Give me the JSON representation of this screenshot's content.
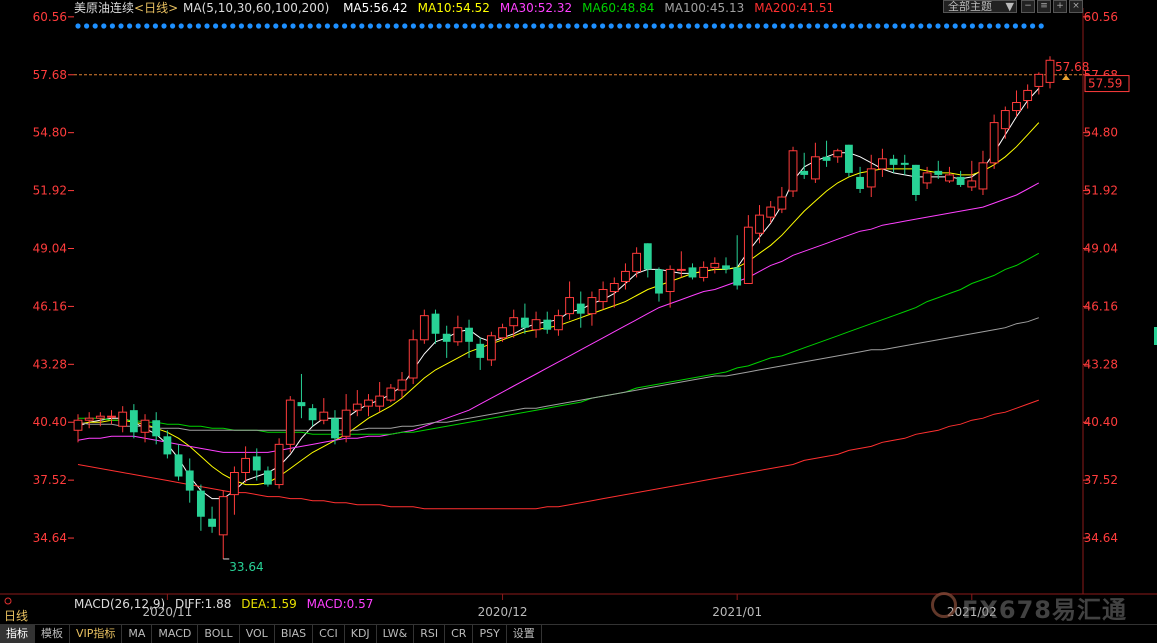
{
  "toolbar": {
    "symbol": "美原油连续",
    "period": "<日线>",
    "ma_params": "MA(5,10,30,60,100,200)",
    "ma_values": [
      {
        "label": "MA5:56.42",
        "color": "#ffffff"
      },
      {
        "label": "MA10:54.52",
        "color": "#ffff00"
      },
      {
        "label": "MA30:52.32",
        "color": "#ff40ff"
      },
      {
        "label": "MA60:48.84",
        "color": "#00d000"
      },
      {
        "label": "MA100:45.13",
        "color": "#a0a0a0"
      },
      {
        "label": "MA200:41.51",
        "color": "#ff3030"
      }
    ],
    "theme_button": "全部主题",
    "theme_arrow": "▼"
  },
  "indicator": {
    "name": "MACD(26,12,9)",
    "diff": "DIFF:1.88",
    "dea": "DEA:1.59",
    "macd": "MACD:0.57"
  },
  "left_tag": "日线",
  "tabs": [
    "指标",
    "模板",
    "VIP指标",
    "MA",
    "MACD",
    "BOLL",
    "VOL",
    "BIAS",
    "CCI",
    "KDJ",
    "LW&",
    "RSI",
    "CR",
    "PSY",
    "设置"
  ],
  "watermark": "FX678易汇通",
  "chart_data": {
    "type": "candlestick",
    "y_ticks": [
      "60.56",
      "57.68",
      "54.80",
      "51.92",
      "49.04",
      "46.16",
      "43.28",
      "40.40",
      "37.52",
      "34.64"
    ],
    "ylim": [
      33.3,
      61.0
    ],
    "x_labels": [
      {
        "label": "2020/11",
        "index": 8
      },
      {
        "label": "2020/12",
        "index": 38
      },
      {
        "label": "2021/01",
        "index": 59
      },
      {
        "label": "2021/02",
        "index": 80
      }
    ],
    "last_price": "57.68",
    "current_value": "57.59",
    "low_label": "33.64",
    "candles": [
      [
        40.0,
        40.5,
        39.4,
        40.8
      ],
      [
        40.5,
        40.6,
        40.1,
        40.9
      ],
      [
        40.6,
        40.7,
        40.2,
        40.9
      ],
      [
        40.7,
        40.7,
        40.3,
        41.0
      ],
      [
        40.2,
        40.9,
        39.9,
        41.2
      ],
      [
        41.0,
        39.9,
        39.6,
        41.3
      ],
      [
        39.9,
        40.5,
        39.4,
        40.8
      ],
      [
        40.5,
        39.7,
        39.3,
        40.9
      ],
      [
        39.7,
        38.8,
        38.6,
        40.0
      ],
      [
        38.8,
        37.7,
        37.5,
        39.3
      ],
      [
        38.0,
        37.0,
        36.4,
        38.6
      ],
      [
        37.0,
        35.7,
        35.0,
        37.3
      ],
      [
        35.6,
        35.2,
        34.9,
        36.2
      ],
      [
        34.8,
        36.7,
        33.6,
        37.0
      ],
      [
        36.8,
        37.9,
        35.8,
        38.2
      ],
      [
        37.9,
        38.6,
        37.4,
        39.2
      ],
      [
        38.7,
        38.0,
        37.5,
        39.1
      ],
      [
        38.0,
        37.3,
        37.2,
        38.2
      ],
      [
        37.3,
        39.3,
        37.1,
        39.6
      ],
      [
        39.3,
        41.5,
        38.9,
        41.7
      ],
      [
        41.4,
        41.2,
        40.6,
        42.8
      ],
      [
        41.1,
        40.5,
        40.2,
        41.3
      ],
      [
        40.5,
        40.9,
        40.3,
        41.6
      ],
      [
        40.6,
        39.6,
        39.3,
        41.0
      ],
      [
        39.7,
        41.0,
        39.4,
        41.8
      ],
      [
        41.0,
        41.3,
        40.7,
        42.0
      ],
      [
        41.2,
        41.5,
        40.7,
        41.8
      ],
      [
        41.2,
        41.7,
        40.9,
        42.4
      ],
      [
        41.5,
        42.1,
        41.4,
        42.3
      ],
      [
        42.0,
        42.5,
        41.6,
        42.9
      ],
      [
        42.6,
        44.5,
        42.3,
        45.0
      ],
      [
        44.5,
        45.7,
        44.3,
        46.0
      ],
      [
        45.8,
        44.8,
        44.3,
        46.0
      ],
      [
        44.8,
        44.4,
        43.6,
        45.2
      ],
      [
        44.4,
        45.1,
        44.2,
        45.7
      ],
      [
        45.1,
        44.4,
        43.6,
        45.5
      ],
      [
        44.3,
        43.6,
        43.0,
        44.6
      ],
      [
        43.5,
        44.7,
        43.2,
        44.9
      ],
      [
        44.6,
        45.1,
        44.4,
        45.3
      ],
      [
        45.2,
        45.6,
        44.6,
        46.0
      ],
      [
        45.6,
        45.1,
        44.8,
        46.3
      ],
      [
        45.0,
        45.5,
        44.6,
        45.9
      ],
      [
        45.5,
        45.0,
        44.8,
        45.9
      ],
      [
        45.0,
        45.7,
        44.7,
        46.0
      ],
      [
        45.8,
        46.6,
        45.5,
        47.4
      ],
      [
        46.3,
        45.8,
        45.1,
        46.9
      ],
      [
        45.8,
        46.6,
        45.2,
        46.9
      ],
      [
        46.4,
        47.0,
        46.0,
        47.4
      ],
      [
        46.9,
        47.3,
        46.1,
        47.6
      ],
      [
        47.4,
        47.9,
        47.0,
        48.3
      ],
      [
        47.9,
        48.8,
        47.6,
        49.1
      ],
      [
        49.3,
        48.0,
        47.6,
        49.3
      ],
      [
        48.0,
        46.8,
        46.4,
        48.1
      ],
      [
        46.9,
        48.0,
        46.1,
        48.2
      ],
      [
        48.0,
        48.0,
        47.6,
        48.9
      ],
      [
        48.1,
        47.6,
        47.5,
        48.3
      ],
      [
        47.6,
        48.1,
        47.4,
        48.4
      ],
      [
        48.1,
        48.3,
        47.8,
        48.6
      ],
      [
        48.2,
        48.0,
        47.8,
        48.6
      ],
      [
        48.1,
        47.2,
        47.0,
        49.7
      ],
      [
        47.3,
        50.1,
        47.3,
        50.7
      ],
      [
        49.8,
        50.7,
        49.3,
        51.2
      ],
      [
        50.6,
        51.1,
        50.3,
        51.4
      ],
      [
        51.0,
        51.6,
        50.8,
        52.1
      ],
      [
        51.9,
        53.9,
        51.6,
        54.1
      ],
      [
        52.9,
        52.7,
        52.5,
        53.8
      ],
      [
        52.5,
        53.6,
        52.3,
        54.3
      ],
      [
        53.6,
        53.4,
        53.1,
        54.4
      ],
      [
        53.6,
        53.9,
        53.3,
        54.0
      ],
      [
        54.2,
        52.8,
        52.6,
        54.2
      ],
      [
        52.6,
        52.0,
        51.8,
        53.1
      ],
      [
        52.1,
        53.0,
        51.6,
        53.7
      ],
      [
        53.0,
        53.5,
        52.6,
        54.0
      ],
      [
        53.5,
        53.2,
        52.8,
        53.7
      ],
      [
        53.3,
        53.2,
        52.7,
        53.7
      ],
      [
        53.2,
        51.7,
        51.4,
        53.2
      ],
      [
        52.3,
        52.8,
        52.0,
        53.1
      ],
      [
        52.9,
        52.7,
        52.5,
        53.4
      ],
      [
        52.4,
        52.7,
        52.3,
        53.1
      ],
      [
        52.6,
        52.2,
        52.1,
        52.9
      ],
      [
        52.1,
        52.4,
        51.9,
        53.4
      ],
      [
        52.0,
        53.3,
        51.7,
        53.9
      ],
      [
        53.3,
        55.3,
        53.0,
        55.7
      ],
      [
        55.0,
        55.9,
        54.5,
        56.1
      ],
      [
        55.9,
        56.3,
        55.6,
        56.9
      ],
      [
        56.4,
        56.9,
        56.0,
        57.2
      ],
      [
        57.1,
        57.7,
        56.7,
        57.8
      ],
      [
        57.3,
        58.4,
        57.0,
        58.6
      ]
    ],
    "ma_lines": [
      {
        "name": "MA5",
        "color": "#ffffff",
        "values": [
          40.2,
          40.4,
          40.5,
          40.6,
          40.6,
          40.4,
          40.1,
          39.8,
          39.3,
          38.6,
          37.7,
          37.0,
          36.6,
          36.6,
          37.0,
          37.5,
          37.7,
          37.9,
          38.2,
          38.8,
          39.6,
          40.2,
          40.6,
          40.6,
          40.6,
          41.0,
          41.3,
          41.5,
          41.8,
          42.2,
          43.0,
          43.8,
          44.4,
          44.6,
          44.9,
          45.0,
          44.6,
          44.4,
          44.6,
          44.8,
          45.1,
          45.3,
          45.4,
          45.5,
          45.9,
          46.0,
          46.3,
          46.5,
          46.8,
          47.3,
          47.8,
          48.0,
          48.0,
          47.9,
          47.8,
          47.8,
          47.9,
          48.0,
          48.0,
          48.1,
          48.9,
          49.6,
          50.3,
          51.2,
          52.4,
          53.1,
          53.4,
          53.6,
          53.8,
          53.8,
          53.6,
          53.3,
          53.0,
          52.8,
          52.7,
          52.6,
          52.6,
          52.6,
          52.6,
          52.5,
          52.6,
          53.0,
          53.8,
          54.7,
          55.6,
          56.4,
          57.0
        ]
      },
      {
        "name": "MA10",
        "color": "#ffff00",
        "values": [
          40.3,
          40.4,
          40.4,
          40.5,
          40.5,
          40.4,
          40.3,
          40.1,
          39.9,
          39.6,
          39.2,
          38.7,
          38.2,
          37.8,
          37.5,
          37.3,
          37.3,
          37.4,
          37.7,
          38.1,
          38.5,
          38.9,
          39.2,
          39.5,
          39.8,
          40.2,
          40.6,
          40.9,
          41.2,
          41.6,
          42.1,
          42.6,
          43.0,
          43.3,
          43.6,
          43.9,
          44.1,
          44.3,
          44.5,
          44.7,
          44.9,
          45.0,
          45.1,
          45.2,
          45.4,
          45.6,
          45.8,
          46.0,
          46.2,
          46.4,
          46.7,
          47.0,
          47.2,
          47.4,
          47.6,
          47.8,
          47.9,
          48.0,
          48.0,
          48.1,
          48.4,
          48.8,
          49.2,
          49.7,
          50.3,
          50.9,
          51.4,
          51.9,
          52.3,
          52.6,
          52.8,
          52.9,
          53.0,
          53.0,
          53.0,
          53.0,
          52.9,
          52.8,
          52.8,
          52.7,
          52.7,
          52.9,
          53.2,
          53.6,
          54.1,
          54.7,
          55.3
        ]
      },
      {
        "name": "MA30",
        "color": "#ff40ff",
        "values": [
          39.5,
          39.6,
          39.6,
          39.7,
          39.7,
          39.7,
          39.6,
          39.5,
          39.4,
          39.3,
          39.2,
          39.1,
          39.0,
          38.9,
          38.9,
          38.9,
          38.9,
          38.9,
          39.0,
          39.1,
          39.2,
          39.3,
          39.4,
          39.5,
          39.6,
          39.6,
          39.7,
          39.7,
          39.8,
          39.9,
          40.0,
          40.2,
          40.4,
          40.6,
          40.8,
          41.0,
          41.3,
          41.6,
          41.9,
          42.2,
          42.5,
          42.8,
          43.1,
          43.4,
          43.7,
          44.0,
          44.3,
          44.6,
          44.9,
          45.2,
          45.5,
          45.8,
          46.1,
          46.3,
          46.5,
          46.7,
          46.9,
          47.0,
          47.2,
          47.4,
          47.6,
          47.9,
          48.2,
          48.4,
          48.7,
          48.9,
          49.1,
          49.3,
          49.5,
          49.7,
          49.9,
          50.0,
          50.2,
          50.3,
          50.4,
          50.5,
          50.6,
          50.7,
          50.8,
          50.9,
          51.0,
          51.1,
          51.3,
          51.5,
          51.7,
          52.0,
          52.3
        ]
      },
      {
        "name": "MA60",
        "color": "#00d000",
        "values": [
          40.6,
          40.6,
          40.6,
          40.5,
          40.5,
          40.5,
          40.4,
          40.4,
          40.3,
          40.3,
          40.2,
          40.2,
          40.1,
          40.1,
          40.0,
          40.0,
          40.0,
          39.9,
          39.9,
          39.9,
          39.9,
          39.8,
          39.8,
          39.8,
          39.8,
          39.8,
          39.8,
          39.8,
          39.8,
          39.9,
          39.9,
          40.0,
          40.1,
          40.2,
          40.3,
          40.4,
          40.5,
          40.6,
          40.7,
          40.8,
          40.9,
          41.0,
          41.1,
          41.2,
          41.3,
          41.4,
          41.6,
          41.7,
          41.8,
          41.9,
          42.1,
          42.2,
          42.3,
          42.4,
          42.5,
          42.6,
          42.7,
          42.8,
          42.9,
          43.1,
          43.2,
          43.4,
          43.6,
          43.7,
          43.9,
          44.1,
          44.3,
          44.5,
          44.7,
          44.9,
          45.1,
          45.3,
          45.5,
          45.7,
          45.9,
          46.1,
          46.4,
          46.6,
          46.8,
          47.0,
          47.3,
          47.5,
          47.7,
          48.0,
          48.2,
          48.5,
          48.8
        ]
      },
      {
        "name": "MA100",
        "color": "#a0a0a0",
        "values": [
          40.4,
          40.3,
          40.3,
          40.3,
          40.2,
          40.2,
          40.2,
          40.1,
          40.1,
          40.1,
          40.0,
          40.0,
          40.0,
          40.0,
          40.0,
          40.0,
          40.0,
          40.0,
          40.0,
          40.0,
          40.0,
          40.0,
          40.0,
          40.0,
          40.0,
          40.0,
          40.1,
          40.1,
          40.1,
          40.2,
          40.2,
          40.3,
          40.4,
          40.4,
          40.5,
          40.6,
          40.7,
          40.8,
          40.9,
          41.0,
          41.1,
          41.1,
          41.2,
          41.3,
          41.4,
          41.5,
          41.6,
          41.7,
          41.8,
          41.9,
          42.0,
          42.1,
          42.2,
          42.3,
          42.4,
          42.5,
          42.6,
          42.7,
          42.7,
          42.8,
          42.9,
          43.0,
          43.1,
          43.2,
          43.3,
          43.4,
          43.5,
          43.6,
          43.7,
          43.8,
          43.9,
          44.0,
          44.0,
          44.1,
          44.2,
          44.3,
          44.4,
          44.5,
          44.6,
          44.7,
          44.8,
          44.9,
          45.0,
          45.1,
          45.3,
          45.4,
          45.6
        ]
      },
      {
        "name": "MA200",
        "color": "#ff3030",
        "values": [
          38.3,
          38.2,
          38.1,
          38.0,
          37.9,
          37.8,
          37.7,
          37.6,
          37.5,
          37.4,
          37.3,
          37.2,
          37.1,
          37.0,
          36.9,
          36.9,
          36.8,
          36.7,
          36.7,
          36.6,
          36.6,
          36.5,
          36.5,
          36.4,
          36.4,
          36.3,
          36.3,
          36.3,
          36.2,
          36.2,
          36.2,
          36.1,
          36.1,
          36.1,
          36.1,
          36.1,
          36.1,
          36.1,
          36.1,
          36.1,
          36.1,
          36.1,
          36.2,
          36.2,
          36.3,
          36.4,
          36.5,
          36.6,
          36.7,
          36.8,
          36.9,
          37.0,
          37.1,
          37.2,
          37.3,
          37.4,
          37.5,
          37.6,
          37.7,
          37.8,
          37.9,
          38.0,
          38.1,
          38.2,
          38.3,
          38.5,
          38.6,
          38.7,
          38.8,
          39.0,
          39.1,
          39.2,
          39.4,
          39.5,
          39.6,
          39.8,
          39.9,
          40.0,
          40.2,
          40.3,
          40.5,
          40.6,
          40.8,
          40.9,
          41.1,
          41.3,
          41.5
        ]
      }
    ]
  },
  "colors": {
    "up": "#ff3c3c",
    "down": "#28d296",
    "axis": "#ff3c3c",
    "dashed": "#e08030",
    "dots": "#1e90ff"
  }
}
